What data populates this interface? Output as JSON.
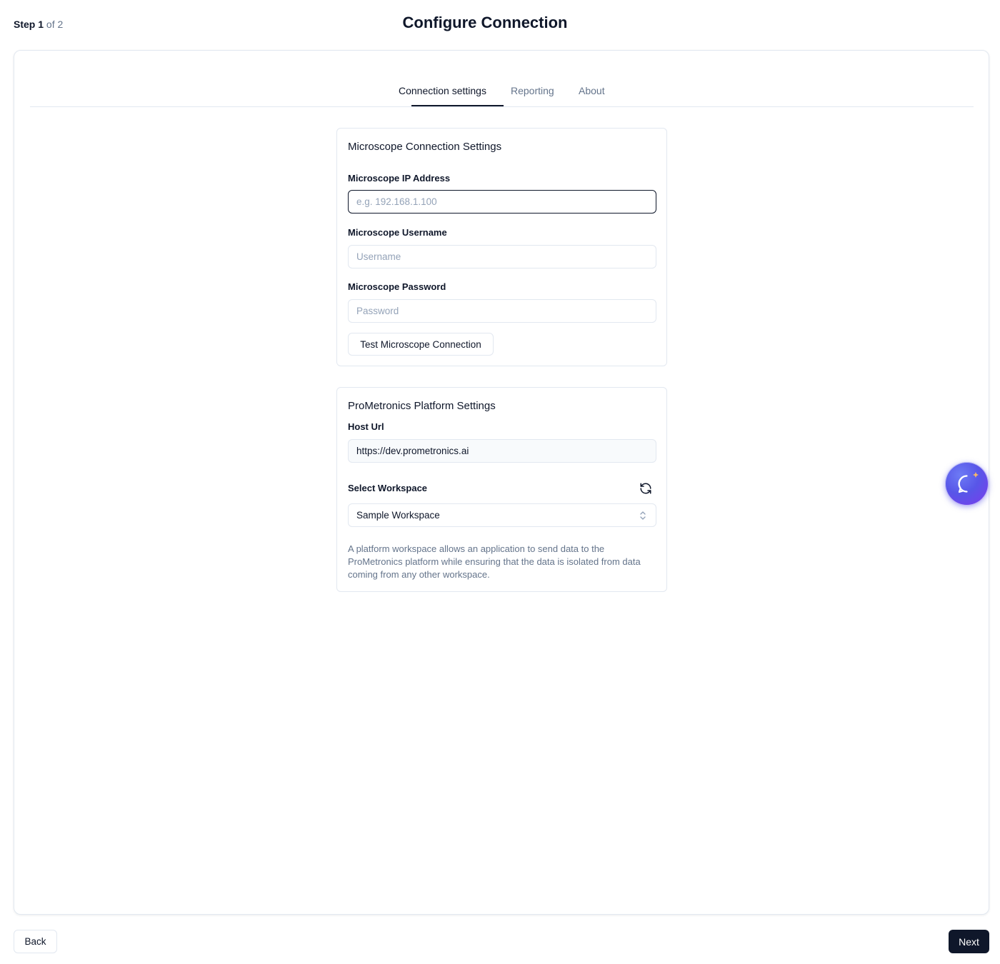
{
  "header": {
    "step_label": "Step",
    "step_current": "1",
    "step_of": "of 2",
    "title": "Configure Connection"
  },
  "tabs": [
    {
      "label": "Connection settings",
      "active": true
    },
    {
      "label": "Reporting",
      "active": false
    },
    {
      "label": "About",
      "active": false
    }
  ],
  "microscope_section": {
    "title": "Microscope Connection Settings",
    "ip_label": "Microscope IP Address",
    "ip_placeholder": "e.g. 192.168.1.100",
    "ip_value": "",
    "username_label": "Microscope Username",
    "username_placeholder": "Username",
    "password_label": "Microscope Password",
    "password_placeholder": "Password",
    "test_button": "Test Microscope Connection"
  },
  "platform_section": {
    "title": "ProMetronics Platform Settings",
    "host_label": "Host Url",
    "host_value": "https://dev.prometronics.ai",
    "workspace_label": "Select Workspace",
    "workspace_value": "Sample Workspace",
    "help_text": "A platform workspace allows an application to send data to the ProMetronics platform while ensuring that the data is isolated from data coming from any other workspace."
  },
  "footer": {
    "back_label": "Back",
    "next_label": "Next"
  },
  "icons": {
    "refresh": "refresh-icon",
    "select_chevron": "chevron-up-down-icon",
    "chat": "chat-bubble-sparkle-icon"
  },
  "colors": {
    "primary": "#0f172a",
    "muted": "#64748b",
    "border": "#e2e8f0",
    "chat_fab": "#5856e8"
  }
}
